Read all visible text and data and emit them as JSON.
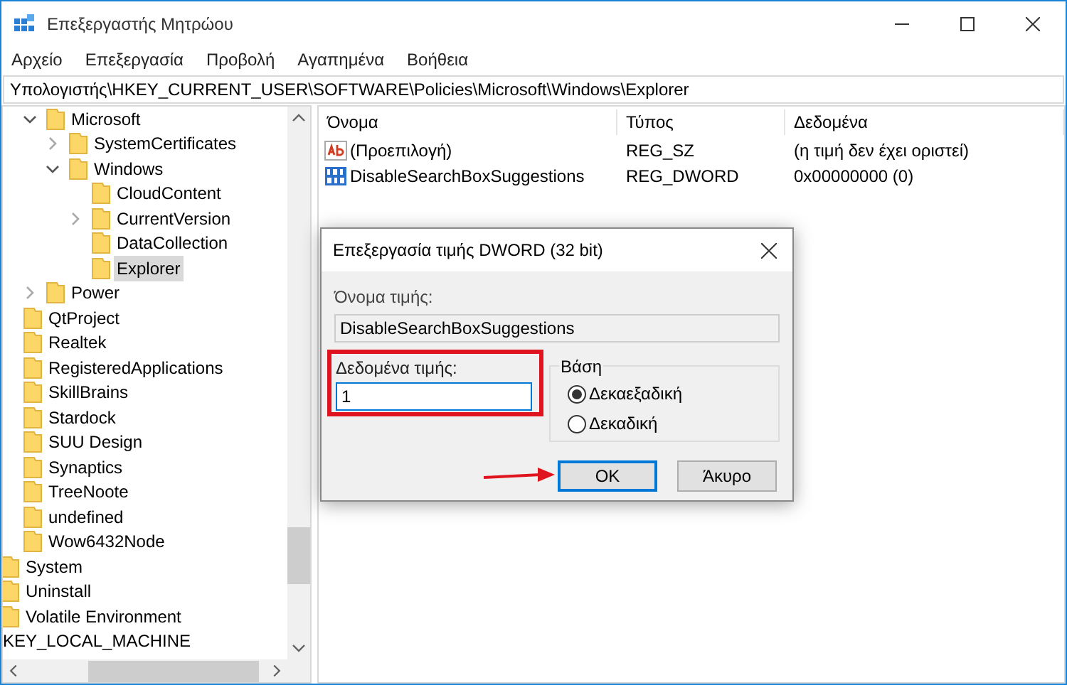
{
  "window": {
    "title": "Επεξεργαστής Μητρώου"
  },
  "menu": [
    "Αρχείο",
    "Επεξεργασία",
    "Προβολή",
    "Αγαπημένα",
    "Βοήθεια"
  ],
  "address": "Υπολογιστής\\HKEY_CURRENT_USER\\SOFTWARE\\Policies\\Microsoft\\Windows\\Explorer",
  "tree": [
    {
      "children": [
        {
          "children": [
            {
              "children": [
                {
                  "label": "Microsoft",
                  "selected": false,
                  "expanded": true,
                  "children": [
                    {
                      "label": "SystemCertificates",
                      "selected": false,
                      "expanded": false
                    },
                    {
                      "label": "Windows",
                      "selected": false,
                      "expanded": true,
                      "children": [
                        {
                          "label": "CloudContent",
                          "selected": false
                        },
                        {
                          "label": "CurrentVersion",
                          "selected": false,
                          "expanded": false
                        },
                        {
                          "label": "DataCollection",
                          "selected": false
                        },
                        {
                          "label": "Explorer",
                          "selected": true
                        }
                      ]
                    }
                  ]
                },
                {
                  "label": "Power",
                  "selected": false,
                  "expanded": false
                }
              ]
            },
            {
              "label": "QtProject",
              "selected": false
            },
            {
              "label": "Realtek",
              "selected": false
            },
            {
              "label": "RegisteredApplications",
              "selected": false
            },
            {
              "label": "SkillBrains",
              "selected": false
            },
            {
              "label": "Stardock",
              "selected": false
            },
            {
              "label": "SUU Design",
              "selected": false
            },
            {
              "label": "Synaptics",
              "selected": false
            },
            {
              "label": "TreeNoote",
              "selected": false
            },
            {
              "label": "undefined",
              "selected": false
            },
            {
              "label": "Wow6432Node",
              "selected": false
            }
          ]
        },
        {
          "label": "System",
          "selected": false
        },
        {
          "label": "Uninstall",
          "selected": false
        },
        {
          "label": "Volatile Environment",
          "selected": false
        }
      ]
    },
    {
      "label": "KEY_LOCAL_MACHINE",
      "selected": false
    }
  ],
  "values": {
    "columns": [
      "Όνομα",
      "Τύπος",
      "Δεδομένα"
    ],
    "rows": [
      {
        "kind": "string",
        "name": "(Προεπιλογή)",
        "type": "REG_SZ",
        "data": "(η τιμή δεν έχει οριστεί)"
      },
      {
        "kind": "binary",
        "name": "DisableSearchBoxSuggestions",
        "type": "REG_DWORD",
        "data": "0x00000000 (0)"
      }
    ]
  },
  "dialog": {
    "title": "Επεξεργασία τιμής DWORD (32 bit)",
    "name_label": "Όνομα τιμής:",
    "name_value": "DisableSearchBoxSuggestions",
    "data_label": "Δεδομένα τιμής:",
    "data_value": "1",
    "base_label": "Βάση",
    "base_options": [
      {
        "label": "Δεκαεξαδική",
        "selected": true
      },
      {
        "label": "Δεκαδική",
        "selected": false
      }
    ],
    "buttons": [
      {
        "label": "OK",
        "default": true
      },
      {
        "label": "Άκυρο",
        "default": false
      }
    ]
  }
}
